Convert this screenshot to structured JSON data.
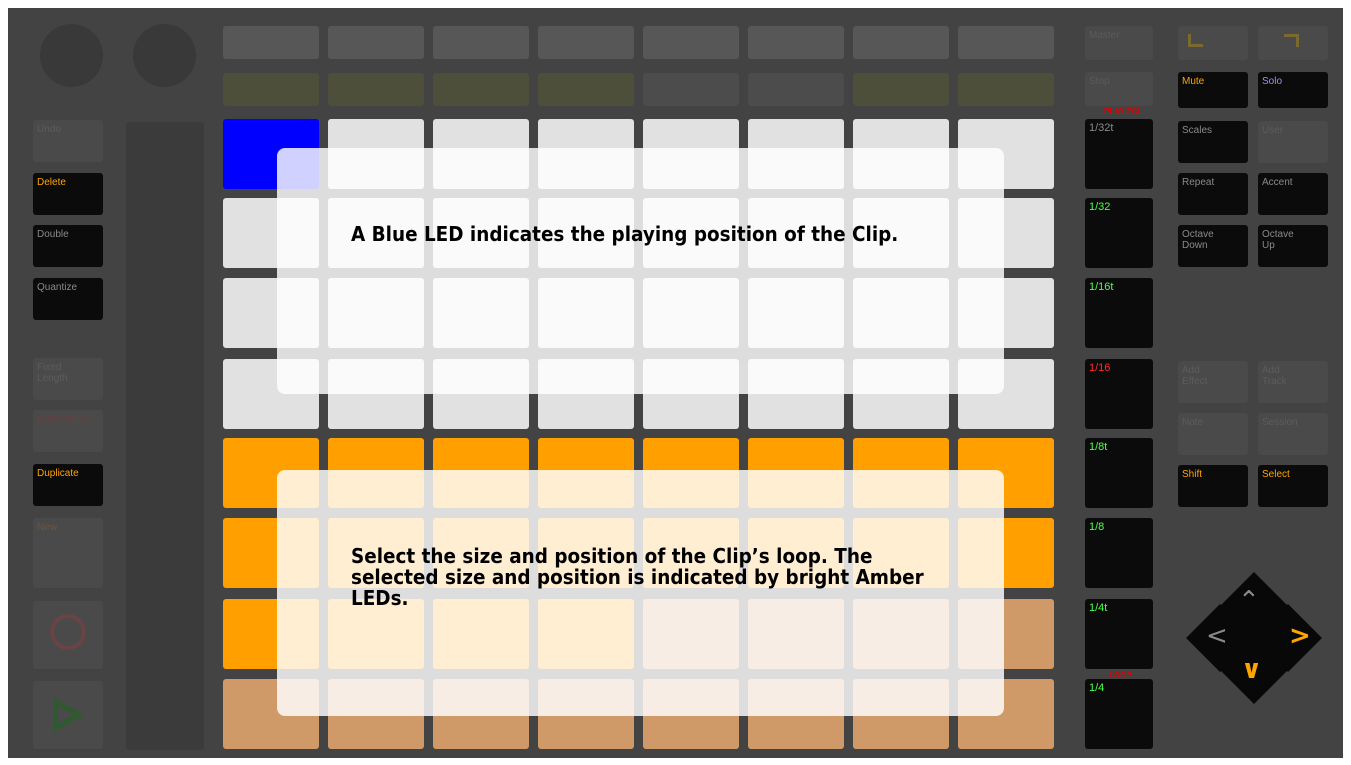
{
  "left_buttons": {
    "undo": "Undo",
    "delete": "Delete",
    "double": "Double",
    "quantize": "Quantize",
    "fixed_length": "Fixed\nLength",
    "automation": "Automation",
    "duplicate": "Duplicate",
    "new": "New"
  },
  "scene_buttons": {
    "master": "Master",
    "stop": "Stop",
    "play_tgl_caption": "PLAY TGL",
    "loop_caption": "LOOP",
    "items": [
      "1/32t",
      "1/32",
      "1/16t",
      "1/16",
      "1/8t",
      "1/8",
      "1/4t",
      "1/4"
    ]
  },
  "right_buttons": {
    "mute": "Mute",
    "solo": "Solo",
    "scales": "Scales",
    "user": "User",
    "repeat": "Repeat",
    "accent": "Accent",
    "octave_down": "Octave\nDown",
    "octave_up": "Octave\nUp",
    "add_effect": "Add\nEffect",
    "add_track": "Add\nTrack",
    "note": "Note",
    "session": "Session",
    "shift": "Shift",
    "select": "Select"
  },
  "overlays": {
    "top": "A Blue LED indicates the playing position of the Clip.",
    "bottom": "Select the size and position of the Clip’s loop. The selected size and position is indicated by bright Amber LEDs."
  },
  "colors": {
    "device_bg": "#434343",
    "blue_led": "#0000ff",
    "amber_bright": "#ffa000",
    "amber_dim": "#d09a68",
    "pad_white": "#e1e1e1",
    "olive_button": "#4e4f3a",
    "label_orange": "#ffa500",
    "label_green": "#4cff4c",
    "label_red": "#ff2a2a",
    "label_purple": "#a08cff"
  },
  "grid": {
    "rows": [
      [
        "blue",
        "white",
        "white",
        "white",
        "white",
        "white",
        "white",
        "white"
      ],
      [
        "white",
        "white",
        "white",
        "white",
        "white",
        "white",
        "white",
        "white"
      ],
      [
        "white",
        "white",
        "white",
        "white",
        "white",
        "white",
        "white",
        "white"
      ],
      [
        "white",
        "white",
        "white",
        "white",
        "white",
        "white",
        "white",
        "white"
      ],
      [
        "amber",
        "amber",
        "amber",
        "amber",
        "amber",
        "amber",
        "amber",
        "amber"
      ],
      [
        "amber",
        "amber",
        "amber",
        "amber",
        "amber",
        "amber",
        "amber",
        "amber"
      ],
      [
        "amber",
        "amber",
        "amber",
        "amber",
        "dim",
        "dim",
        "dim",
        "dim"
      ],
      [
        "dim",
        "dim",
        "dim",
        "dim",
        "dim",
        "dim",
        "dim",
        "dim"
      ]
    ]
  },
  "icons": {
    "record": "record-circle-icon",
    "play": "play-triangle-icon",
    "up": "arrow-up-icon",
    "down": "arrow-down-icon",
    "left": "arrow-left-icon",
    "right": "arrow-right-icon",
    "octave_down_top": "return-arrow-icon",
    "undo_top": "undo-arrow-icon"
  }
}
